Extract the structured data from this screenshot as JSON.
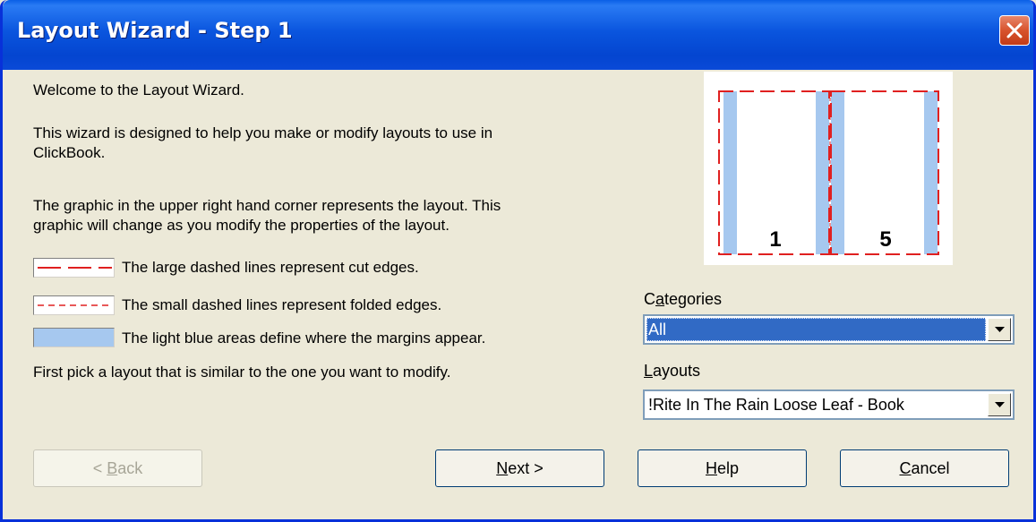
{
  "window": {
    "title": "Layout Wizard - Step 1",
    "close_icon": "close-icon"
  },
  "intro": {
    "welcome": "Welcome to the Layout Wizard.",
    "line1": "This wizard is designed to help you make or modify layouts to use in",
    "line2": "ClickBook.",
    "line3": "The graphic in the upper right hand corner represents the layout.  This",
    "line4": "graphic will change as you modify the properties of the layout."
  },
  "legend": [
    {
      "text": "The large dashed lines represent cut edges."
    },
    {
      "text": "The small dashed lines represent folded edges."
    },
    {
      "text": "The light blue areas define where the margins appear."
    }
  ],
  "instruction": "First pick a layout that is similar to the one you want to modify.",
  "preview": {
    "page_numbers": [
      "1",
      "5"
    ],
    "cut_color": "#e02020",
    "margin_color": "#a6c8ef"
  },
  "categories": {
    "label_pre": "C",
    "label_ul": "a",
    "label_post": "tegories",
    "value": "All"
  },
  "layouts": {
    "label_pre": "",
    "label_ul": "L",
    "label_post": "ayouts",
    "value": "!Rite In The Rain Loose Leaf - Book"
  },
  "buttons": {
    "back": {
      "pre": "< ",
      "ul": "B",
      "post": "ack"
    },
    "next": {
      "pre": "",
      "ul": "N",
      "post": "ext >"
    },
    "help": {
      "pre": "",
      "ul": "H",
      "post": "elp"
    },
    "cancel": {
      "pre": "",
      "ul": "C",
      "post": "ancel"
    }
  }
}
